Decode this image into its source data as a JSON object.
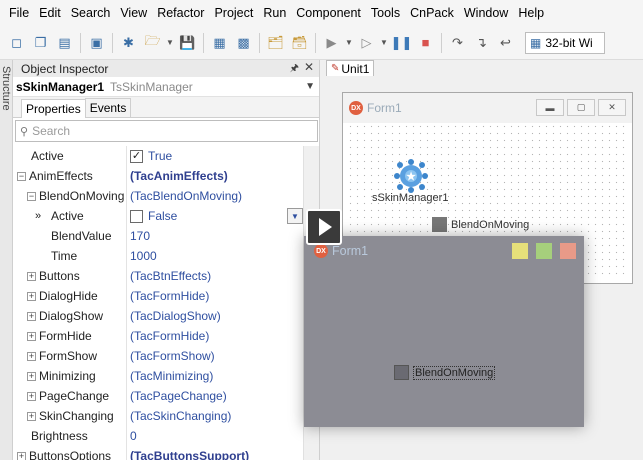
{
  "menu": [
    "File",
    "Edit",
    "Search",
    "View",
    "Refactor",
    "Project",
    "Run",
    "Component",
    "Tools",
    "CnPack",
    "Window",
    "Help"
  ],
  "toolbar": {
    "platform_label": "32-bit Wi"
  },
  "structure_tab_label": "Structure",
  "object_inspector": {
    "title": "Object Inspector",
    "component_name": "sSkinManager1",
    "component_class": "TsSkinManager",
    "tabs": [
      "Properties",
      "Events"
    ],
    "search_placeholder": "Search",
    "properties": [
      {
        "name": "Active",
        "value": "True"
      },
      {
        "name": "AnimEffects",
        "value": "(TacAnimEffects)"
      },
      {
        "name": "BlendOnMoving",
        "value": "(TacBlendOnMoving)"
      },
      {
        "name": "Active",
        "value": "False"
      },
      {
        "name": "BlendValue",
        "value": "170"
      },
      {
        "name": "Time",
        "value": "1000"
      },
      {
        "name": "Buttons",
        "value": "(TacBtnEffects)"
      },
      {
        "name": "DialogHide",
        "value": "(TacFormHide)"
      },
      {
        "name": "DialogShow",
        "value": "(TacDialogShow)"
      },
      {
        "name": "FormHide",
        "value": "(TacFormHide)"
      },
      {
        "name": "FormShow",
        "value": "(TacFormShow)"
      },
      {
        "name": "Minimizing",
        "value": "(TacMinimizing)"
      },
      {
        "name": "PageChange",
        "value": "(TacPageChange)"
      },
      {
        "name": "SkinChanging",
        "value": "(TacSkinChanging)"
      },
      {
        "name": "Brightness",
        "value": "0"
      },
      {
        "name": "ButtonsOptions",
        "value": "(TacButtonsSupport)"
      }
    ]
  },
  "designer": {
    "unit_tab": "Unit1",
    "form_caption": "Form1",
    "dx_logo": "DX",
    "component_label": "sSkinManager1",
    "checkbox_label": "BlendOnMoving"
  },
  "preview": {
    "dx_logo": "DX",
    "caption": "Form1",
    "checkbox_label": "BlendOnMoving",
    "button_colors": [
      "#e6e07a",
      "#a6cf7c",
      "#e89a88"
    ]
  }
}
